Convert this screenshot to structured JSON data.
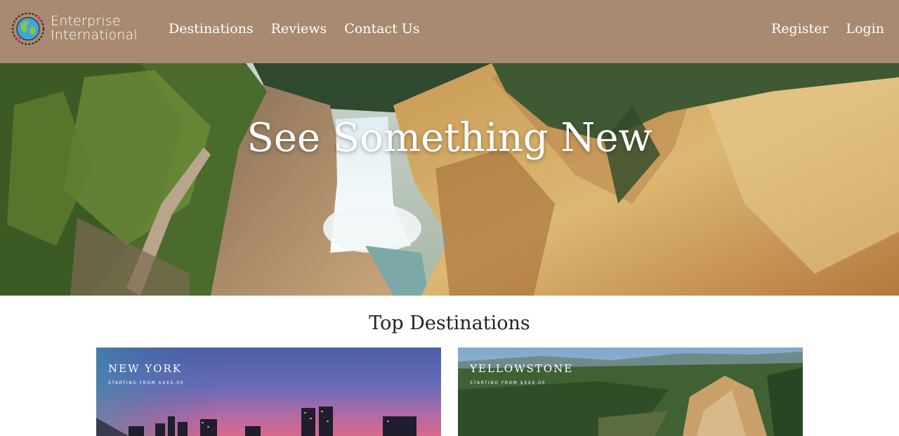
{
  "brand": {
    "name_line1": "Enterprise",
    "name_line2": "International"
  },
  "nav": {
    "left": [
      "Destinations",
      "Reviews",
      "Contact Us"
    ],
    "right": [
      "Register",
      "Login"
    ]
  },
  "hero": {
    "title": "See Something New"
  },
  "section": {
    "title": "Top Destinations"
  },
  "cards": [
    {
      "name": "New York",
      "price": "Starting from $xxx.00"
    },
    {
      "name": "Yellowstone",
      "price": "Starting from $xxx.00"
    }
  ],
  "colors": {
    "header_bg": "#a78a71",
    "text_on_dark": "#ffffff",
    "heading_text": "#222222"
  },
  "icons": {
    "logo": "globe-icon"
  }
}
